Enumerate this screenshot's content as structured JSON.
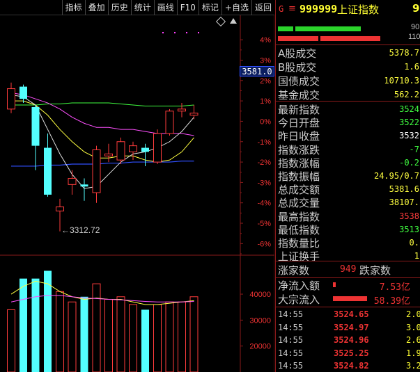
{
  "toolbar": {
    "buttons": [
      "指标",
      "叠加",
      "历史",
      "统计",
      "画线",
      "F10",
      "标记",
      "+自选",
      "返回"
    ]
  },
  "chart": {
    "current_price_label": "3581.0",
    "low_label": "3312.72",
    "pct_ticks": [
      "4%",
      "3%",
      "2%",
      "1%",
      "0%",
      "-1%",
      "-2%",
      "-3%",
      "-4%",
      "-5%",
      "-6%"
    ],
    "vol_ticks": [
      "40000",
      "30000",
      "20000"
    ],
    "colors": {
      "up": "#ff3c3c",
      "down": "#54ffff",
      "ma5": "#e0e0e0",
      "ma10": "#ffff40",
      "ma20": "#ff50ff",
      "ma60": "#40ff40",
      "base": "#3050ff"
    }
  },
  "chart_data": {
    "type": "candlestick",
    "candles": [
      {
        "dir": "up",
        "o_pct": 0.6,
        "c_pct": 1.6,
        "h_pct": 1.9,
        "l_pct": 0.4
      },
      {
        "dir": "down",
        "o_pct": 1.7,
        "c_pct": 1.1,
        "h_pct": 1.8,
        "l_pct": 0.9
      },
      {
        "dir": "down",
        "o_pct": 0.7,
        "c_pct": -1.2,
        "h_pct": 0.8,
        "l_pct": -2.4
      },
      {
        "dir": "down",
        "o_pct": -1.3,
        "c_pct": -3.6,
        "h_pct": -0.6,
        "l_pct": -3.7
      },
      {
        "dir": "up",
        "o_pct": -4.4,
        "c_pct": -4.2,
        "h_pct": -3.8,
        "l_pct": -5.4
      },
      {
        "dir": "up",
        "o_pct": -3.1,
        "c_pct": -2.8,
        "h_pct": -2.4,
        "l_pct": -3.6
      },
      {
        "dir": "down",
        "o_pct": -3.1,
        "c_pct": -3.2,
        "h_pct": -2.8,
        "l_pct": -3.9
      },
      {
        "dir": "up",
        "o_pct": -3.5,
        "c_pct": -1.4,
        "h_pct": -1.2,
        "l_pct": -4.0
      },
      {
        "dir": "up",
        "o_pct": -1.7,
        "c_pct": -1.6,
        "h_pct": -1.1,
        "l_pct": -2.0
      },
      {
        "dir": "up",
        "o_pct": -1.9,
        "c_pct": -1.0,
        "h_pct": -0.8,
        "l_pct": -2.1
      },
      {
        "dir": "up",
        "o_pct": -1.5,
        "c_pct": -1.2,
        "h_pct": -1.0,
        "l_pct": -1.9
      },
      {
        "dir": "down",
        "o_pct": -1.3,
        "c_pct": -1.5,
        "h_pct": -1.1,
        "l_pct": -2.2
      },
      {
        "dir": "up",
        "o_pct": -2.0,
        "c_pct": -0.6,
        "h_pct": -0.4,
        "l_pct": -2.1
      },
      {
        "dir": "up",
        "o_pct": -0.6,
        "c_pct": 0.5,
        "h_pct": 0.6,
        "l_pct": -0.7
      },
      {
        "dir": "up",
        "o_pct": 0.5,
        "c_pct": 0.6,
        "h_pct": 0.9,
        "l_pct": 0.2
      },
      {
        "dir": "up",
        "o_pct": 0.3,
        "c_pct": 0.4,
        "h_pct": 0.8,
        "l_pct": 0.1
      }
    ],
    "volumes": [
      {
        "dir": "up",
        "v": 34000
      },
      {
        "dir": "down",
        "v": 46000
      },
      {
        "dir": "down",
        "v": 46000
      },
      {
        "dir": "down",
        "v": 49000
      },
      {
        "dir": "up",
        "v": 41000
      },
      {
        "dir": "up",
        "v": 37000
      },
      {
        "dir": "down",
        "v": 39000
      },
      {
        "dir": "up",
        "v": 44000
      },
      {
        "dir": "up",
        "v": 38000
      },
      {
        "dir": "up",
        "v": 39000
      },
      {
        "dir": "up",
        "v": 36000
      },
      {
        "dir": "down",
        "v": 34000
      },
      {
        "dir": "up",
        "v": 36000
      },
      {
        "dir": "up",
        "v": 37000
      },
      {
        "dir": "up",
        "v": 37000
      },
      {
        "dir": "up",
        "v": 39000
      }
    ],
    "ylim_pct": [
      -6.5,
      5.2
    ],
    "vol_lim": [
      10000,
      52000
    ]
  },
  "panel": {
    "indicator": "G",
    "eq": "≡",
    "code": "999999",
    "name": "上证指数",
    "extra": "9",
    "bar_top_num": "90",
    "bar_bot_num": "110",
    "rows": [
      {
        "label": "A股成交",
        "value": "5378.7",
        "color": "#ffff40"
      },
      {
        "label": "B股成交",
        "value": "1.6",
        "color": "#ffff40"
      },
      {
        "label": "国债成交",
        "value": "10710.3",
        "color": "#ffff40"
      },
      {
        "label": "基金成交",
        "value": "562.2",
        "color": "#ffff40"
      },
      {
        "label": "最新指数",
        "value": "3524",
        "color": "#40ff40"
      },
      {
        "label": "今日开盘",
        "value": "3522",
        "color": "#40ff40"
      },
      {
        "label": "昨日收盘",
        "value": "3532",
        "color": "#ffffff"
      },
      {
        "label": "指数涨跌",
        "value": "-7",
        "color": "#40ff40"
      },
      {
        "label": "指数涨幅",
        "value": "-0.2",
        "color": "#40ff40"
      },
      {
        "label": "指数振幅",
        "value": "24.95/0.7",
        "color": "#ffff40"
      },
      {
        "label": "总成交额",
        "value": "5381.6",
        "color": "#ffff40"
      },
      {
        "label": "总成交量",
        "value": "38107.",
        "color": "#ffff40"
      },
      {
        "label": "最高指数",
        "value": "3538",
        "color": "#ff3c3c"
      },
      {
        "label": "最低指数",
        "value": "3513",
        "color": "#40ff40"
      },
      {
        "label": "指数量比",
        "value": "0.",
        "color": "#ffff40"
      },
      {
        "label": "上证换手",
        "value": "1",
        "color": "#ffff40"
      }
    ],
    "up_label": "涨家数",
    "up_count": "949",
    "down_label": "跌家数",
    "flows": [
      {
        "label": "净流入额",
        "value": "7.53亿",
        "bar_frac": 0.05
      },
      {
        "label": "大宗流入",
        "value": "58.39亿",
        "bar_frac": 0.7
      }
    ],
    "ticks": [
      {
        "time": "14:55",
        "price": "3524.65",
        "vol": "2.0"
      },
      {
        "time": "14:55",
        "price": "3524.97",
        "vol": "3.0"
      },
      {
        "time": "14:55",
        "price": "3524.96",
        "vol": "2.6"
      },
      {
        "time": "14:55",
        "price": "3525.25",
        "vol": "1.9"
      },
      {
        "time": "14:55",
        "price": "3524.82",
        "vol": "3.2"
      }
    ]
  }
}
